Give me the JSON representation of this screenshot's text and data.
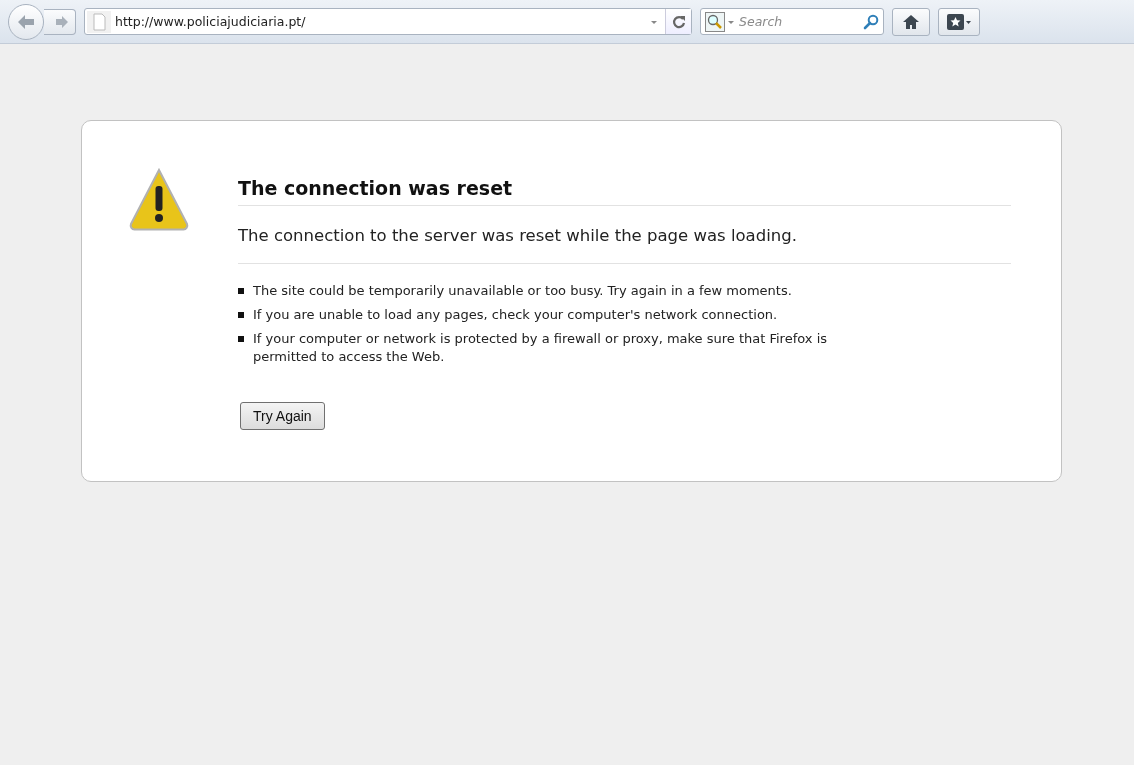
{
  "toolbar": {
    "address": "http://www.policiajudiciaria.pt/",
    "search": {
      "placeholder": "Search"
    }
  },
  "error": {
    "title": "The connection was reset",
    "description": "The connection to the server was reset while the page was loading.",
    "suggestions": [
      "The site could be temporarily unavailable or too busy. Try again in a few moments.",
      "If you are unable to load any pages, check your computer's network connection.",
      "If your computer or network is protected by a firewall or proxy, make sure that Firefox is permitted to access the Web."
    ],
    "button": "Try Again"
  }
}
